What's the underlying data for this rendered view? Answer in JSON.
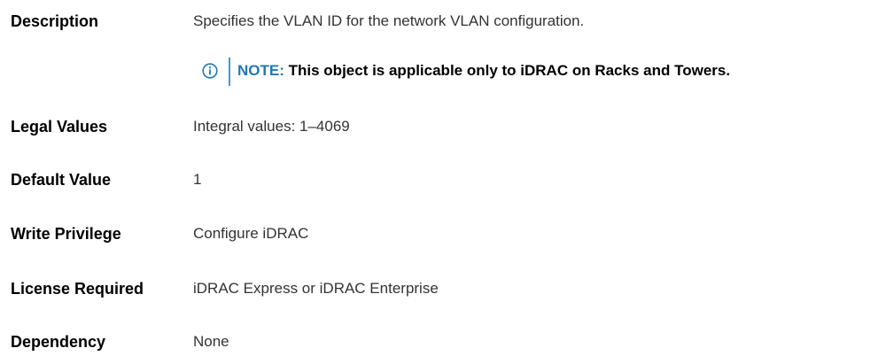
{
  "rows": [
    {
      "label": "Description",
      "value": "Specifies the VLAN ID for the network VLAN configuration."
    },
    {
      "label": "Legal Values",
      "value": "Integral values: 1–4069"
    },
    {
      "label": "Default Value",
      "value": "1"
    },
    {
      "label": "Write Privilege",
      "value": "Configure iDRAC"
    },
    {
      "label": "License Required",
      "value": "iDRAC Express or iDRAC Enterprise"
    },
    {
      "label": "Dependency",
      "value": "None"
    }
  ],
  "note": {
    "prefix": "NOTE:",
    "text": "This object is applicable only to iDRAC on Racks and Towers.",
    "icon": "info-icon"
  },
  "colors": {
    "note_accent": "#1f78b4",
    "divider": "#3a9ad9"
  }
}
